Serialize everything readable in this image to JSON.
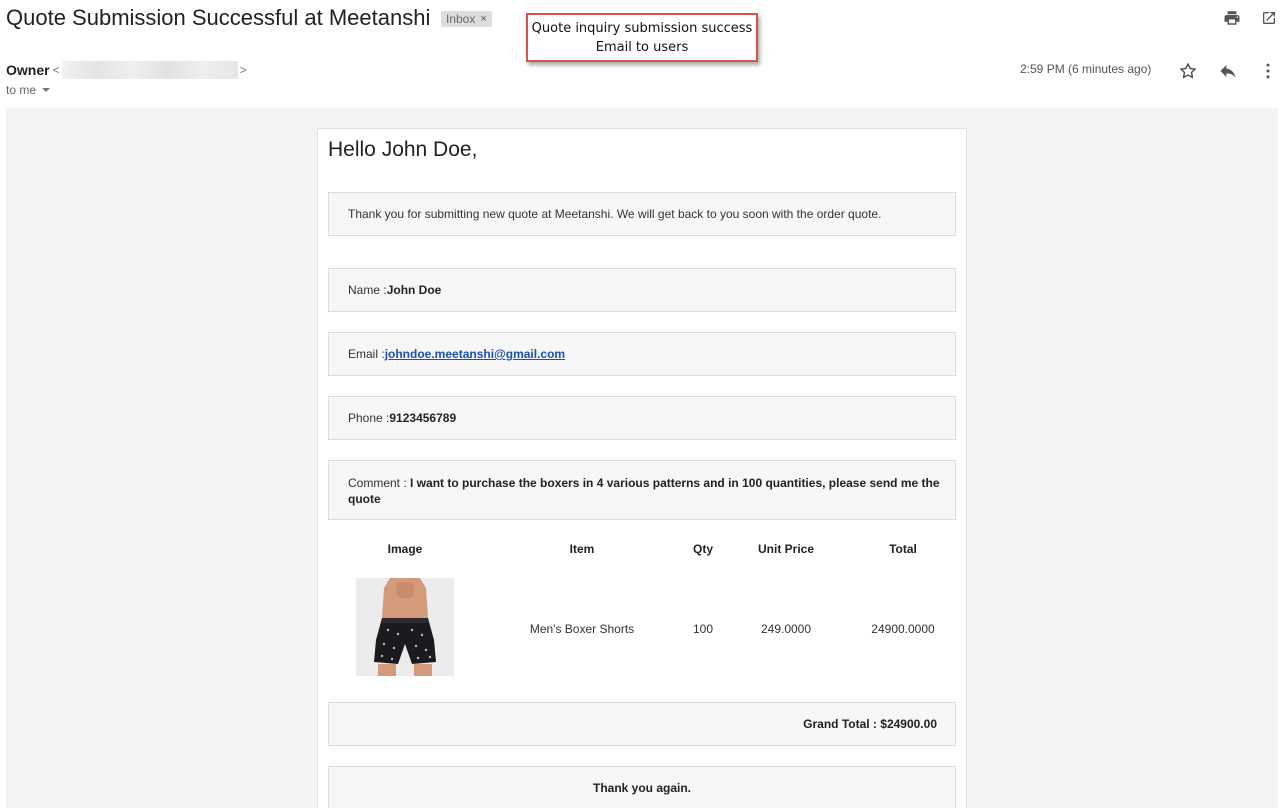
{
  "email": {
    "subject": "Quote Submission Successful at Meetanshi",
    "label": "Inbox",
    "label_remove": "×",
    "sender_name": "Owner",
    "sender_open": "<",
    "sender_close": ">",
    "recipient": "to me",
    "timestamp": "2:59 PM (6 minutes ago)"
  },
  "annotation": {
    "line1": "Quote inquiry submission success",
    "line2": "Email to users"
  },
  "icons": {
    "print": "print-icon",
    "popout": "open-in-new-window-icon",
    "star": "star-icon",
    "reply": "reply-icon",
    "more": "more-vert-icon",
    "dropdown": "chevron-down-icon"
  },
  "body": {
    "greeting": "Hello John Doe,",
    "intro": "Thank you for submitting new quote at Meetanshi. We will get back to you soon with the order quote.",
    "name_label": "Name : ",
    "name_value": "John Doe",
    "email_label": "Email : ",
    "email_value": "johndoe.meetanshi@gmail.com",
    "phone_label": "Phone : ",
    "phone_value": "9123456789",
    "comment_label": "Comment : ",
    "comment_value_line1": "I want to purchase the boxers in 4 various patterns and in 100 quantities, please send me the",
    "comment_value_line2": "quote",
    "table": {
      "headers": [
        "Image",
        "Item",
        "Qty",
        "Unit Price",
        "Total"
      ],
      "rows": [
        {
          "item": "Men's Boxer Shorts",
          "qty": "100",
          "unit_price": "249.0000",
          "total": "24900.0000"
        }
      ]
    },
    "grand_total": "Grand Total : $24900.00",
    "thanks": "Thank you again."
  },
  "colors": {
    "link": "#1a4fb5",
    "callout_border": "#d9534f",
    "box_bg": "#f7f7f7",
    "mail_bg": "#f3f3f3"
  }
}
